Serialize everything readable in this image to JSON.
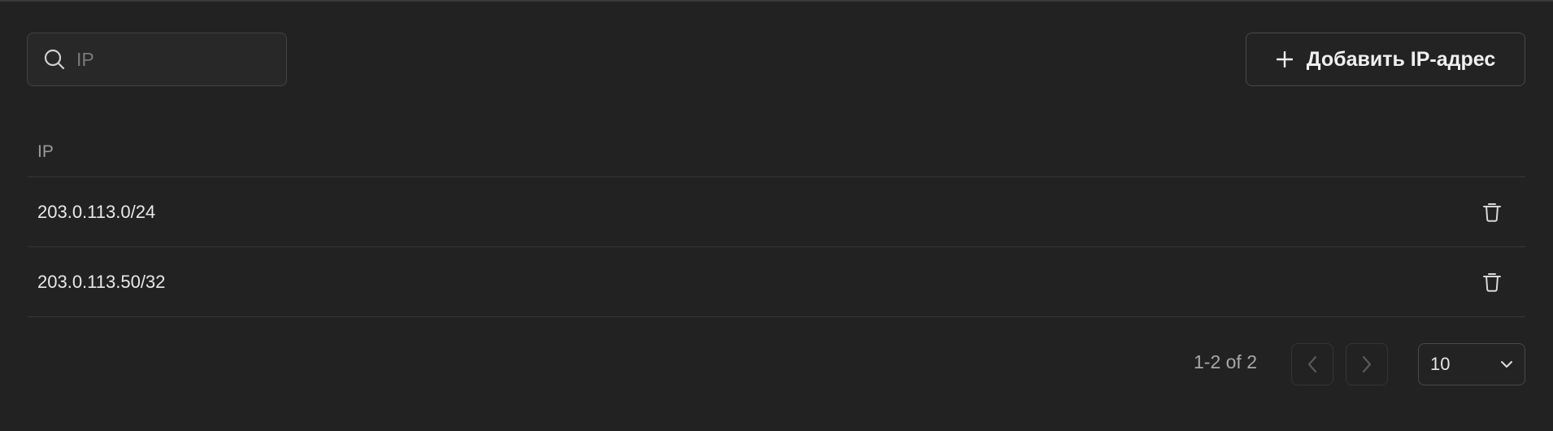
{
  "toolbar": {
    "search_placeholder": "IP",
    "search_value": "",
    "add_button_label": "Добавить IP-адрес"
  },
  "table": {
    "column_header": "IP",
    "rows": [
      {
        "ip": "203.0.113.0/24"
      },
      {
        "ip": "203.0.113.50/32"
      }
    ]
  },
  "pagination": {
    "range_text": "1-2 of 2",
    "page_size": "10"
  },
  "icons": {
    "search": "search-icon",
    "add": "plus-icon",
    "delete": "trash-icon",
    "prev": "chevron-left-icon",
    "next": "chevron-right-icon",
    "dropdown": "chevron-down-icon"
  },
  "colors": {
    "background": "#222222",
    "border": "#444444",
    "text": "#e6e6e6",
    "muted": "#9a9a9a"
  }
}
